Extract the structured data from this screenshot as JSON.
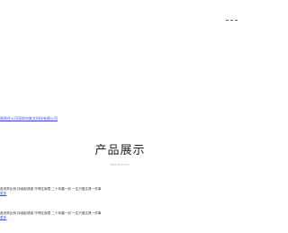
{
  "header": {
    "menu_icon": "menu-dashes-icon"
  },
  "company_strip": {
    "link_1": "限责任公司",
    "link_2": "深圳市联文科技有限公司"
  },
  "products": {
    "title": "产品展示",
    "subtitle": "PRODUCTS"
  },
  "items": [
    {
      "text": "各贵宾比例 持续起诱惑 守得住寂寞 二十年磨一剑 一生只做文具一件事",
      "link": "更多"
    },
    {
      "text": "各贵宾比例 持续起诱惑 守得住寂寞 二十年磨一剑 一生只做文具一件事",
      "link": "更多"
    }
  ],
  "colors": {
    "link": "#3a4fd0",
    "title": "#222222",
    "subtitle": "#9a9a9a",
    "body_text": "#333333"
  }
}
